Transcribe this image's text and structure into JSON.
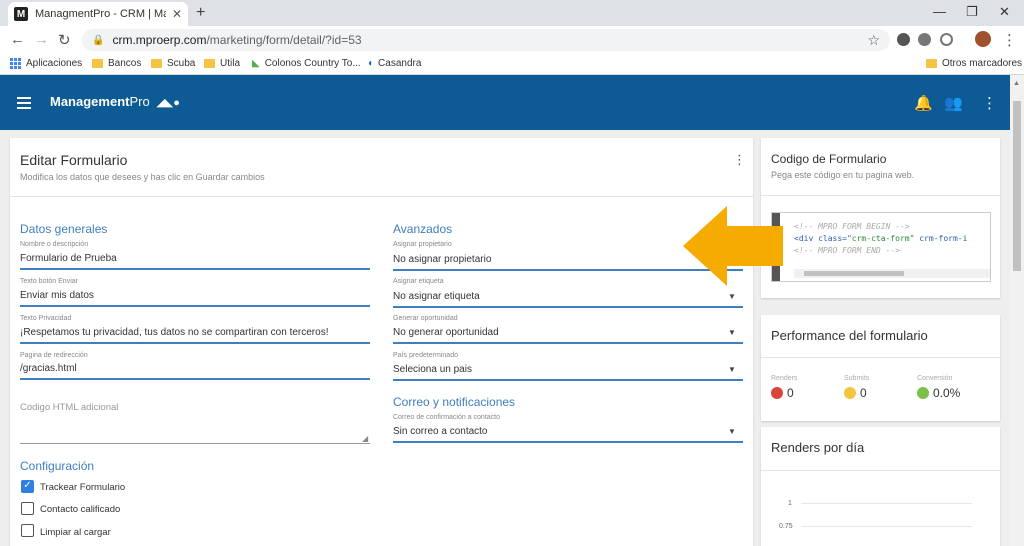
{
  "browser": {
    "tab_title": "ManagmentPro - CRM | Manage",
    "url_host": "crm.mproerp.com",
    "url_path": "/marketing/form/detail/?id=53",
    "bookmarks": [
      "Aplicaciones",
      "Bancos",
      "Scuba",
      "Utila",
      "Colonos Country To...",
      "Casandra"
    ],
    "other_bookmarks": "Otros marcadores"
  },
  "app": {
    "brand_bold": "Management",
    "brand_light": "Pro"
  },
  "form_card": {
    "title": "Editar Formulario",
    "subtitle": "Modifica los datos que desees y has clic en Guardar cambios"
  },
  "general": {
    "title": "Datos generales",
    "fields": [
      {
        "label": "Nombre o descripción",
        "value": "Formulario de Prueba"
      },
      {
        "label": "Texto botón Enviar",
        "value": "Enviar mis datos"
      },
      {
        "label": "Texto Privacidad",
        "value": "¡Respetamos tu privacidad, tus datos no se compartiran con terceros!"
      },
      {
        "label": "Pagina de redirección",
        "value": "/gracias.html"
      }
    ],
    "html_label": "Codigo HTML adicional"
  },
  "config": {
    "title": "Configuración",
    "options": [
      {
        "label": "Trackear Formulario",
        "checked": true
      },
      {
        "label": "Contacto calificado",
        "checked": false
      },
      {
        "label": "Limpiar al cargar",
        "checked": false
      }
    ]
  },
  "advanced": {
    "title": "Avanzados",
    "fields": [
      {
        "label": "Asignar propietario",
        "value": "No asignar propietario"
      },
      {
        "label": "Asignar etiqueta",
        "value": "No asignar etiqueta"
      },
      {
        "label": "Generar oportunidad",
        "value": "No generar oportunidad"
      },
      {
        "label": "País predeterminado",
        "value": "Seleciona un pais"
      }
    ]
  },
  "mail": {
    "title": "Correo y notificaciones",
    "label": "Correo de confirmación a contacto",
    "value": "Sin correo a contacto"
  },
  "code_card": {
    "title": "Codigo de Formulario",
    "subtitle": "Pega este código en tu pagina web.",
    "line1": "<!-- MPRO FORM BEGIN -->",
    "line2_tag": "<div class=",
    "line2_str": "\"crm-cta-form\"",
    "line2_rest": " crm-form-i",
    "line3": "<!-- MPRO FORM END -->"
  },
  "performance": {
    "title": "Performance del formulario",
    "stats": [
      {
        "label": "Renders",
        "value": "0",
        "color": "#d9453a"
      },
      {
        "label": "Submits",
        "value": "0",
        "color": "#f4c542"
      },
      {
        "label": "Conversión",
        "value": "0.0%",
        "color": "#7cc04b"
      }
    ]
  },
  "renders": {
    "title": "Renders por día",
    "ticks": [
      "1",
      "0.75"
    ]
  },
  "colors": {
    "header": "#0d5a94",
    "accent": "#3f7fc0",
    "arrow": "#f5ab00"
  }
}
